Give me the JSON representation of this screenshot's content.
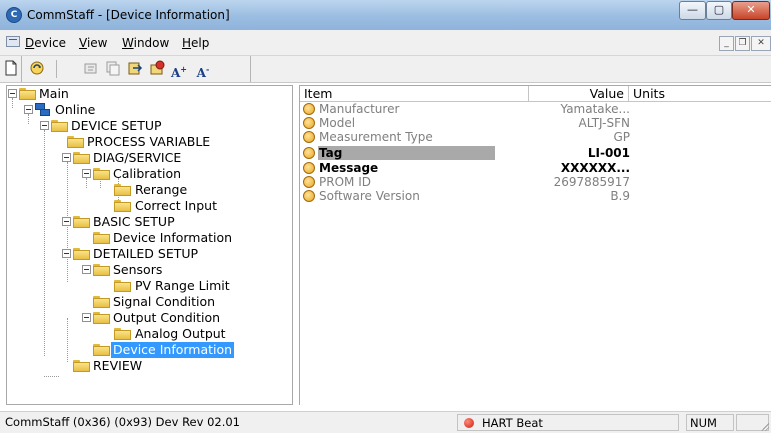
{
  "window": {
    "title": "CommStaff - [Device Information]",
    "controls": {
      "minimize": "—",
      "maximize": "▢",
      "close": "✕"
    }
  },
  "menubar": {
    "items": [
      "Device",
      "View",
      "Window",
      "Help"
    ],
    "mdi_controls": {
      "minimize": "_",
      "restore": "❐",
      "close": "✕"
    }
  },
  "toolbar": {
    "icons": [
      "new-document-icon",
      "refresh-icon",
      "disabled-edit-icon",
      "disabled-copy-icon",
      "export-icon",
      "upload-icon",
      "font-increase-icon",
      "font-decrease-icon"
    ],
    "font_increase_label": "A",
    "font_increase_sup": "+",
    "font_decrease_label": "A",
    "font_decrease_sup": "-"
  },
  "tree": {
    "nodes": [
      {
        "label": "Main"
      },
      {
        "label": "Online"
      },
      {
        "label": "DEVICE SETUP"
      },
      {
        "label": "PROCESS VARIABLE"
      },
      {
        "label": "DIAG/SERVICE"
      },
      {
        "label": "Calibration"
      },
      {
        "label": "Rerange"
      },
      {
        "label": "Correct Input"
      },
      {
        "label": "BASIC SETUP"
      },
      {
        "label": "Device Information"
      },
      {
        "label": "DETAILED SETUP"
      },
      {
        "label": "Sensors"
      },
      {
        "label": "PV Range Limit"
      },
      {
        "label": "Signal Condition"
      },
      {
        "label": "Output Condition"
      },
      {
        "label": "Analog Output"
      },
      {
        "label": "Device Information",
        "selected": true
      },
      {
        "label": "REVIEW"
      }
    ]
  },
  "parameters": {
    "columns": {
      "item": "Item",
      "value": "Value",
      "units": "Units"
    },
    "rows": [
      {
        "item": "Manufacturer",
        "value": "Yamatake...",
        "bold": false
      },
      {
        "item": "Model",
        "value": "ALTJ-SFN",
        "bold": false
      },
      {
        "item": "Measurement Type",
        "value": "GP",
        "bold": false
      },
      {
        "item": "Tag",
        "value": "LI-001",
        "bold": true
      },
      {
        "item": "Message",
        "value": "XXXXXX...",
        "bold": true
      },
      {
        "item": "PROM ID",
        "value": "2697885917",
        "bold": false
      },
      {
        "item": "Software Version",
        "value": "B.9",
        "bold": false
      }
    ]
  },
  "statusbar": {
    "device_info": "CommStaff  (0x36)  (0x93) Dev Rev 02.01",
    "hart_status": "HART Beat",
    "num_lock": "NUM"
  },
  "colors": {
    "selection": "#3399ff",
    "row_highlight": "#a9a9a9",
    "disabled_text": "#7f7f7f"
  }
}
